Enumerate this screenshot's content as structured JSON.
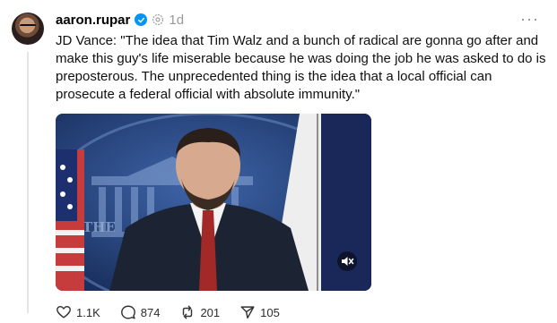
{
  "post": {
    "username": "aaron.rupar",
    "time": "1d",
    "more_label": "···",
    "text": "JD Vance: \"The idea that Tim Walz and a bunch of radical are gonna go after and make this guy's life miserable because he was doing the job he was asked to do is preposterous. The unprecedented thing is the idea that a local official can prosecute a federal official with absolute immunity.\"",
    "video": {
      "backdrop_text": "THE",
      "muted": true
    },
    "actions": {
      "likes": "1.1K",
      "replies": "874",
      "reposts": "201",
      "shares": "105"
    }
  },
  "icons": {
    "verified": "verified-badge-icon",
    "ai_label": "ai-info-icon",
    "like": "heart-icon",
    "reply": "comment-icon",
    "repost": "repost-icon",
    "share": "send-icon",
    "mute": "muted-speaker-icon"
  },
  "colors": {
    "verified": "#0095f6",
    "timestamp": "#999999",
    "text": "#101010"
  }
}
